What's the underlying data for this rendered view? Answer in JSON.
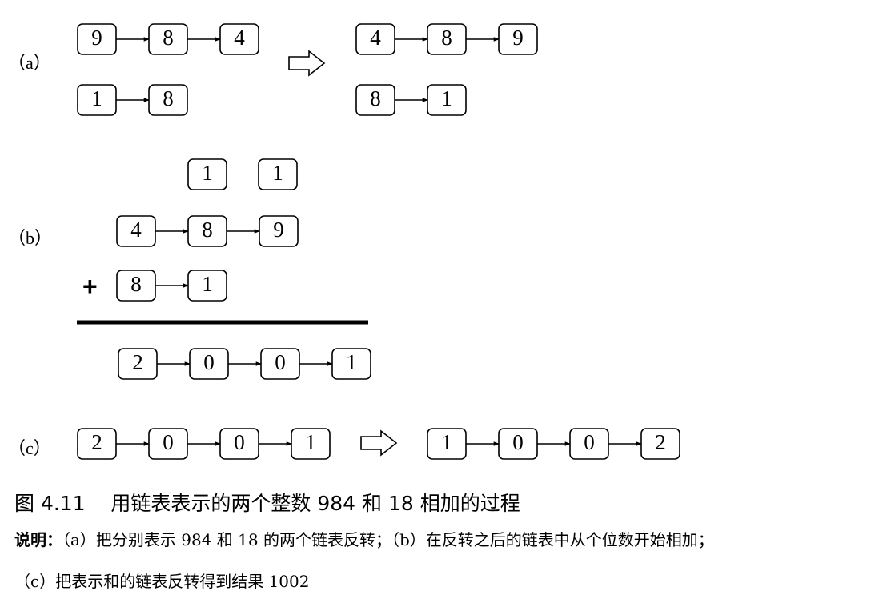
{
  "colors": {
    "stroke": "#000000",
    "background": "#ffffff"
  },
  "parts": {
    "a": {
      "label": "（a）",
      "before": [
        [
          "9",
          "8",
          "4"
        ],
        [
          "1",
          "8"
        ]
      ],
      "after": [
        [
          "4",
          "8",
          "9"
        ],
        [
          "8",
          "1"
        ]
      ]
    },
    "b": {
      "label": "（b）",
      "carries": [
        "1",
        "1"
      ],
      "addend1": [
        "4",
        "8",
        "9"
      ],
      "plus": "+",
      "addend2": [
        "8",
        "1"
      ],
      "sum": [
        "2",
        "0",
        "0",
        "1"
      ]
    },
    "c": {
      "label": "（c）",
      "before": [
        "2",
        "0",
        "0",
        "1"
      ],
      "after": [
        "1",
        "0",
        "0",
        "2"
      ]
    }
  },
  "caption": {
    "number": "图 4.11",
    "title": "用链表表示的两个整数 984 和 18 相加的过程"
  },
  "description": {
    "prefix": "说明：",
    "line1": "（a）把分别表示 984 和 18 的两个链表反转；（b）在反转之后的链表中从个位数开始相加；",
    "line2": "（c）把表示和的链表反转得到结果 1002"
  }
}
